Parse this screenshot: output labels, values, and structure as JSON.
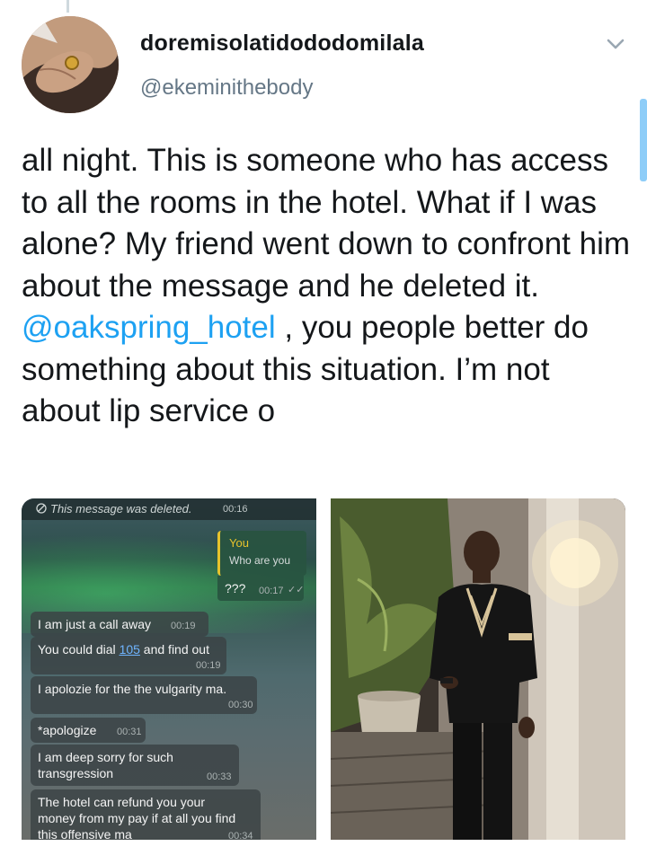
{
  "tweet": {
    "display_name": "doremisolatidododomilala",
    "handle": "@ekeminithebody",
    "text_before": "all night. This is someone who has access to all the rooms in the hotel. What if I was alone? My friend went down to confront him about the message and he deleted it. ",
    "mention": "@oakspring_hotel",
    "text_after": " , you people better do something about this situation. I’m not about lip service o"
  },
  "screenshot": {
    "deleted": {
      "text": "This message was deleted.",
      "time": "00:16"
    },
    "reply": {
      "author": "You",
      "quoted": "Who are you",
      "text": "???",
      "time": "00:17",
      "ticks": "✓✓"
    },
    "messages": [
      {
        "text": "I am just a call away",
        "time": "00:19"
      },
      {
        "pre": "You could dial ",
        "link": "105",
        "post": " and find out",
        "time": "00:19"
      },
      {
        "text": "I apolozie for the the vulgarity ma.",
        "time": "00:30"
      },
      {
        "text": "*apologize",
        "time": "00:31"
      },
      {
        "line1": "I am deep sorry for such",
        "line2": "transgression",
        "time": "00:33"
      },
      {
        "line1": "The hotel can refund you your",
        "line2": "money from my pay if at all you find",
        "line3": "this offensive ma",
        "time": "00:34"
      }
    ]
  },
  "icons": {
    "chevron": "chevron-down-icon",
    "deleted": "blocked-icon",
    "avatar": "avatar"
  },
  "colors": {
    "accent": "#1da1f2",
    "secondary_text": "#657786",
    "primary_text": "#14171a"
  }
}
